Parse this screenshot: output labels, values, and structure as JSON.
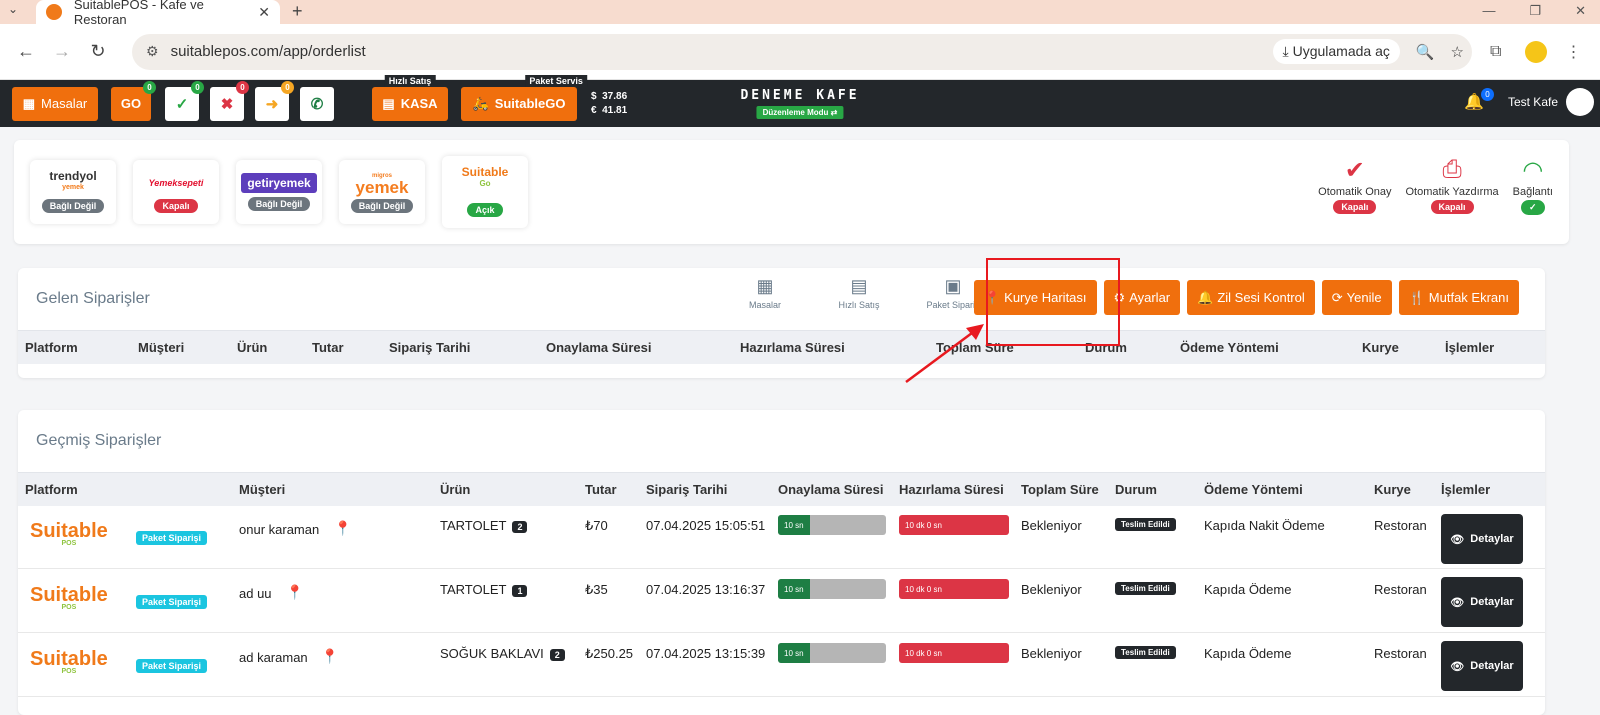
{
  "browser": {
    "tab_title": "SuitablePOS - Kafe ve Restoran",
    "url": "suitablepos.com/app/orderlist",
    "open_in_app": "Uygulamada aç"
  },
  "topbar": {
    "tables_label": "Masalar",
    "go_label": "GO",
    "go_badge": "0",
    "check_badge": "0",
    "cross_badge": "0",
    "arrow_badge": "0",
    "quick_sale_label": "Hızlı Satış",
    "kasa_label": "KASA",
    "package_label": "Paket Servis",
    "suitablego_label": "SuitableGO",
    "usd": "37.86",
    "eur": "41.81",
    "usd_symbol": "$",
    "eur_symbol": "€",
    "cafe_name": "DENEME KAFE",
    "mode_label": "Düzenleme Modu",
    "notif_badge": "0",
    "user_name": "Test Kafe"
  },
  "platforms": [
    {
      "name": "trendyol",
      "sub": "yemek",
      "status": "Bağlı Değil",
      "color": "#6c757d"
    },
    {
      "name": "Yemeksepeti",
      "sub": "",
      "status": "Kapalı",
      "color": "#dc3545"
    },
    {
      "name": "getiryemek",
      "sub": "",
      "status": "Bağlı Değil",
      "color": "#6c757d"
    },
    {
      "name": "yemek",
      "sub": "migros",
      "status": "Bağlı Değil",
      "color": "#6c757d"
    },
    {
      "name": "Suitable",
      "sub": "Go",
      "status": "Açık",
      "color": "#28a745"
    }
  ],
  "stats": {
    "auto_approve": "Otomatik Onay",
    "auto_approve_status": "Kapalı",
    "auto_print": "Otomatik Yazdırma",
    "auto_print_status": "Kapalı",
    "connection": "Bağlantı"
  },
  "incoming": {
    "title": "Gelen Siparişler",
    "icon_tables": "Masalar",
    "icon_quick": "Hızlı Satış",
    "icon_package": "Paket Sipariş",
    "btn_courier_map": "Kurye Haritası",
    "btn_settings": "Ayarlar",
    "btn_bell": "Zil Sesi Kontrol",
    "btn_refresh": "Yenile",
    "btn_kitchen": "Mutfak Ekranı",
    "columns": [
      "Platform",
      "Müşteri",
      "Ürün",
      "Tutar",
      "Sipariş Tarihi",
      "Onaylama Süresi",
      "Hazırlama Süresi",
      "Toplam Süre",
      "Durum",
      "Ödeme Yöntemi",
      "Kurye",
      "İşlemler"
    ]
  },
  "past": {
    "title": "Geçmiş Siparişler",
    "columns": [
      "Platform",
      "Müşteri",
      "Ürün",
      "Tutar",
      "Sipariş Tarihi",
      "Onaylama Süresi",
      "Hazırlama Süresi",
      "Toplam Süre",
      "Durum",
      "Ödeme Yöntemi",
      "Kurye",
      "İşlemler"
    ],
    "rows": [
      {
        "platform_logo": "Suitable",
        "platform_logo_sub": "POS",
        "tag": "Paket Siparişi",
        "customer": "onur karaman",
        "product": "TARTOLET",
        "qty": "2",
        "amount": "₺70",
        "date": "07.04.2025 15:05:51",
        "approve": "10 sn",
        "approve_fraction": 0.3,
        "prepare": "10 dk 0 sn",
        "total": "Bekleniyor",
        "status": "Teslim Edildi",
        "payment": "Kapıda Nakit Ödeme",
        "courier": "Restoran",
        "action": "Detaylar"
      },
      {
        "platform_logo": "Suitable",
        "platform_logo_sub": "POS",
        "tag": "Paket Siparişi",
        "customer": "ad uu",
        "product": "TARTOLET",
        "qty": "1",
        "amount": "₺35",
        "date": "07.04.2025 13:16:37",
        "approve": "10 sn",
        "approve_fraction": 0.3,
        "prepare": "10 dk 0 sn",
        "total": "Bekleniyor",
        "status": "Teslim Edildi",
        "payment": "Kapıda Ödeme",
        "courier": "Restoran",
        "action": "Detaylar"
      },
      {
        "platform_logo": "Suitable",
        "platform_logo_sub": "POS",
        "tag": "Paket Siparişi",
        "customer": "ad karaman",
        "product": "SOĞUK BAKLAVI",
        "qty": "2",
        "amount": "₺250.25",
        "date": "07.04.2025 13:15:39",
        "approve": "10 sn",
        "approve_fraction": 0.3,
        "prepare": "10 dk 0 sn",
        "total": "Bekleniyor",
        "status": "Teslim Edildi",
        "payment": "Kapıda Ödeme",
        "courier": "Restoran",
        "action": "Detaylar"
      }
    ]
  }
}
